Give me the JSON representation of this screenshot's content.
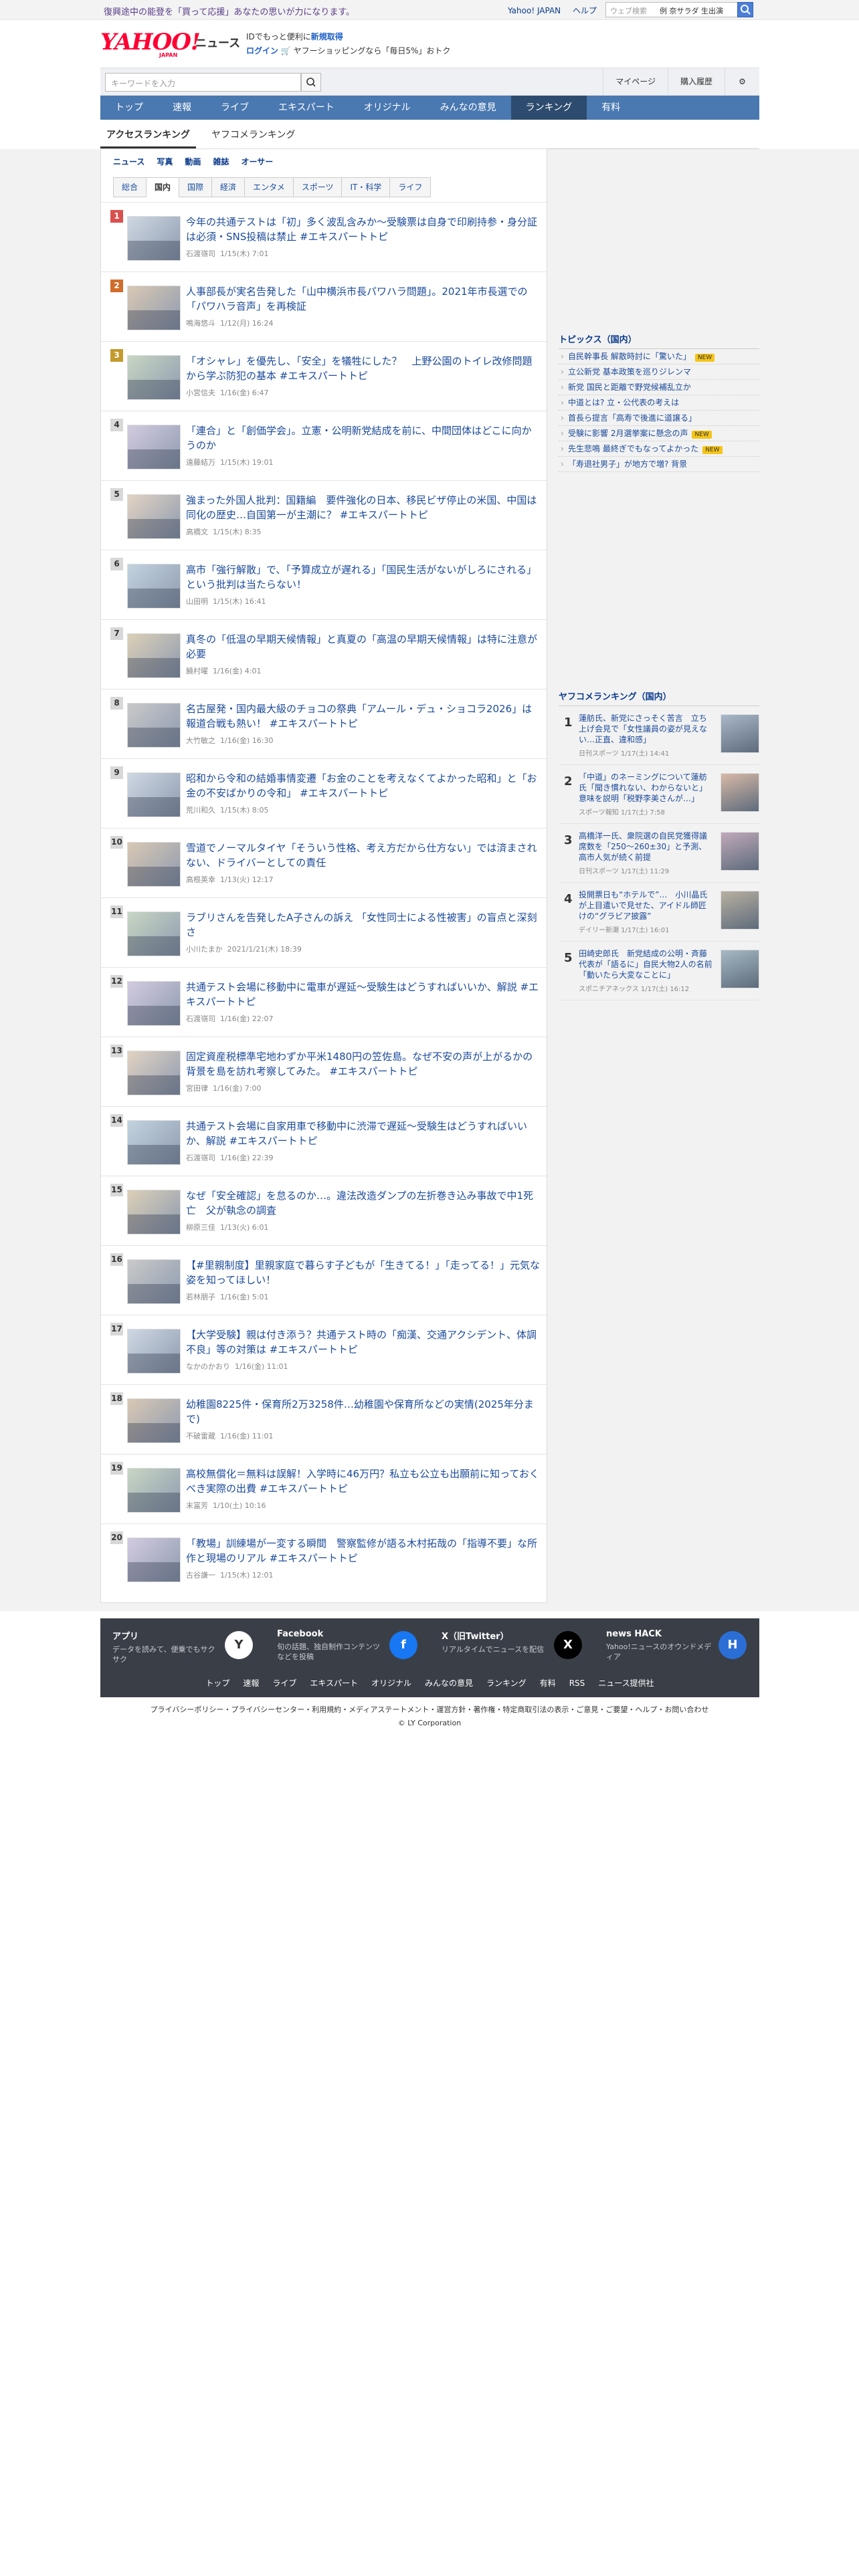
{
  "topbar": {
    "promo": "復興途中の能登を「買って応援」あなたの思いが力になります。",
    "links": [
      "Yahoo! JAPAN",
      "ヘルプ"
    ],
    "search_placeholder": "ウェブ検索",
    "search_example": "例 奈サラダ 生出演"
  },
  "header": {
    "logo": "YAHOO!",
    "logo_sub": "JAPAN",
    "service": "ニュース",
    "pr_line1_a": "IDでもっと便利に",
    "pr_line1_b": "新規取得",
    "pr_line2_a": "ログイン",
    "pr_line2_b": "ヤフーショッピングなら「毎日5%」おトク"
  },
  "search": {
    "placeholder": "キーワードを入力",
    "mypage": "マイページ",
    "history": "購入履歴"
  },
  "nav": {
    "items": [
      "トップ",
      "速報",
      "ライブ",
      "エキスパート",
      "オリジナル",
      "みんなの意見",
      "ランキング",
      "有料"
    ],
    "active": "ランキング"
  },
  "subtabs": [
    "アクセスランキング",
    "ヤフコメランキング"
  ],
  "cats1": [
    "ニュース",
    "写真",
    "動画",
    "雑誌",
    "オーサー"
  ],
  "cats2": [
    "総合",
    "国内",
    "国際",
    "経済",
    "エンタメ",
    "スポーツ",
    "IT・科学",
    "ライフ"
  ],
  "ranking": [
    {
      "rank": "1",
      "title": "今年の共通テストは「初」多く波乱含みか〜受験票は自身で印刷持参・身分証は必須・SNS投稿は禁止 #エキスパートトピ",
      "author": "石渡嶺司",
      "date": "1/15(木) 7:01"
    },
    {
      "rank": "2",
      "title": "人事部長が実名告発した「山中横浜市長パワハラ問題」。2021年市長選での「パワハラ音声」を再検証",
      "author": "鳴海悠斗",
      "date": "1/12(月) 16:24"
    },
    {
      "rank": "3",
      "title": "「オシャレ」を優先し、「安全」を犠牲にした？　上野公園のトイレ改修問題から学ぶ防犯の基本 #エキスパートトピ",
      "author": "小宮信夫",
      "date": "1/16(金) 6:47"
    },
    {
      "rank": "4",
      "title": "「連合」と「創価学会」。立憲・公明新党結成を前に、中間団体はどこに向かうのか",
      "author": "遠藤結万",
      "date": "1/15(木) 19:01"
    },
    {
      "rank": "5",
      "title": "強まった外国人批判：国籍編　要件強化の日本、移民ビザ停止の米国、中国は同化の歴史…自国第一が主潮に？ #エキスパートトピ",
      "author": "高橋文",
      "date": "1/15(木) 8:35"
    },
    {
      "rank": "6",
      "title": "高市「強行解散」で、「予算成立が遅れる」「国民生活がないがしろにされる」という批判は当たらない！",
      "author": "山田明",
      "date": "1/15(木) 16:41"
    },
    {
      "rank": "7",
      "title": "真冬の「低温の早期天候情報」と真夏の「高温の早期天候情報」は特に注意が必要",
      "author": "饒村曜",
      "date": "1/16(金) 4:01"
    },
    {
      "rank": "8",
      "title": "名古屋発・国内最大級のチョコの祭典「アムール・デュ・ショコラ2026」は報道合戦も熱い！ #エキスパートトピ",
      "author": "大竹敏之",
      "date": "1/16(金) 16:30"
    },
    {
      "rank": "9",
      "title": "昭和から令和の結婚事情変遷「お金のことを考えなくてよかった昭和」と「お金の不安ばかりの令和」 #エキスパートトピ",
      "author": "荒川和久",
      "date": "1/15(木) 8:05"
    },
    {
      "rank": "10",
      "title": "雪道でノーマルタイヤ「そういう性格、考え方だから仕方ない」では済まされない、ドライバーとしての責任",
      "author": "高根英幸",
      "date": "1/13(火) 12:17"
    },
    {
      "rank": "11",
      "title": "ラブリさんを告発したA子さんの訴え 「女性同士による性被害」の盲点と深刻さ",
      "author": "小川たまか",
      "date": "2021/1/21(木) 18:39"
    },
    {
      "rank": "12",
      "title": "共通テスト会場に移動中に電車が遅延〜受験生はどうすればいいか、解説 #エキスパートトピ",
      "author": "石渡嶺司",
      "date": "1/16(金) 22:07"
    },
    {
      "rank": "13",
      "title": "固定資産税標準宅地わずか平米1480円の笠佐島。なぜ不安の声が上がるかの背景を島を訪れ考察してみた。 #エキスパートトピ",
      "author": "宮田律",
      "date": "1/16(金) 7:00"
    },
    {
      "rank": "14",
      "title": "共通テスト会場に自家用車で移動中に渋滞で遅延〜受験生はどうすればいいか、解説 #エキスパートトピ",
      "author": "石渡嶺司",
      "date": "1/16(金) 22:39"
    },
    {
      "rank": "15",
      "title": "なぜ「安全確認」を怠るのか…。違法改造ダンプの左折巻き込み事故で中1死亡　父が執念の調査",
      "author": "柳原三佳",
      "date": "1/13(火) 6:01"
    },
    {
      "rank": "16",
      "title": "【#里親制度】里親家庭で暮らす子どもが「生きてる！」「走ってる！」元気な姿を知ってほしい！",
      "author": "若林朋子",
      "date": "1/16(金) 5:01"
    },
    {
      "rank": "17",
      "title": "【大学受験】親は付き添う？共通テスト時の「痴漢、交通アクシデント、体調不良」等の対策は #エキスパートトピ",
      "author": "なかのかおり",
      "date": "1/16(金) 11:01"
    },
    {
      "rank": "18",
      "title": "幼稚園8225件・保育所2万3258件…幼稚園や保育所などの実情(2025年分まで)",
      "author": "不破雷蔵",
      "date": "1/16(金) 11:01"
    },
    {
      "rank": "19",
      "title": "高校無償化＝無料は誤解！入学時に46万円？私立も公立も出願前に知っておくべき実際の出費 #エキスパートトピ",
      "author": "末冨芳",
      "date": "1/10(土) 10:16"
    },
    {
      "rank": "20",
      "title": "「教場」訓練場が一変する瞬間　警察監修が語る木村拓哉の「指導不要」な所作と現場のリアル #エキスパートトピ",
      "author": "古谷謙一",
      "date": "1/15(木) 12:01"
    }
  ],
  "topics": {
    "heading": "トピックス（国内）",
    "items": [
      {
        "text": "自民幹事長 解散時討に「驚いた」",
        "new": "NEW"
      },
      {
        "text": "立公新党 基本政策を巡りジレンマ",
        "new": ""
      },
      {
        "text": "新党 国民と距離で野党候補乱立か",
        "new": ""
      },
      {
        "text": "中道とは? 立・公代表の考えは",
        "new": ""
      },
      {
        "text": "首長ら提言「高寿で後進に道譲る」",
        "new": ""
      },
      {
        "text": "受験に影響 2月選挙案に懸念の声",
        "new": "NEW"
      },
      {
        "text": "先生悲鳴 最終ぎでもなってよかった",
        "new": "NEW"
      },
      {
        "text": "「寿退社男子」が地方で増? 背景",
        "new": ""
      }
    ]
  },
  "yahoo_comment_ranking": {
    "heading": "ヤフコメランキング（国内）",
    "items": [
      {
        "rank": "1",
        "title": "蓮舫氏、新党にさっそく苦言　立ち上げ会見で「女性議員の姿が見えない…正直、違和感」",
        "meta": "日刊スポーツ 1/17(土) 14:41"
      },
      {
        "rank": "2",
        "title": "「中道」のネーミングについて蓮舫氏「聞き慣れない、わからないと」意味を説明「税野李美さんが…」",
        "meta": "スポーツ報知 1/17(土) 7:58"
      },
      {
        "rank": "3",
        "title": "高橋洋一氏、衆院選の自民党獲得議席数を「250〜260±30」と予測、高市人気が続く前提",
        "meta": "日刊スポーツ 1/17(土) 11:29"
      },
      {
        "rank": "4",
        "title": "投開票日も“ホテルで”…　小川晶氏が上目遣いで見せた、アイドル師匠けの“グラビア披露”",
        "meta": "デイリー新潮 1/17(土) 16:01"
      },
      {
        "rank": "5",
        "title": "田崎史郎氏　新党結成の公明・斉藤代表が「語るに」自民大物2人の名前「動いたら大変なことに」",
        "meta": "スポニチアネックス 1/17(土) 16:12"
      }
    ]
  },
  "footer": {
    "apps": [
      {
        "name": "アプリ",
        "desc": "データを読みて、便乗でもサクサク",
        "icon": "Y"
      },
      {
        "name": "Facebook",
        "desc": "旬の話題、独自制作コンテンツなどを投稿",
        "icon": "f"
      },
      {
        "name": "X（旧Twitter）",
        "desc": "リアルタイムでニュースを配信",
        "icon": "X"
      },
      {
        "name": "news HACK",
        "desc": "Yahoo!ニュースのオウンドメディア",
        "icon": "H"
      }
    ],
    "links": [
      "トップ",
      "速報",
      "ライブ",
      "エキスパート",
      "オリジナル",
      "みんなの意見",
      "ランキング",
      "有料",
      "RSS",
      "ニュース提供社"
    ],
    "legal": "プライバシーポリシー・プライバシーセンター・利用規約・メディアステートメント・運営方針・著作権・特定商取引法の表示・ご意見・ご要望・ヘルプ・お問い合わせ",
    "copyright": "© LY Corporation"
  },
  "colors": {
    "nav": "#4a78b0",
    "nav_active": "#2d4b6e",
    "link": "#1b4a9a",
    "rank1": "#d9514e",
    "footer": "#3a3f47"
  }
}
